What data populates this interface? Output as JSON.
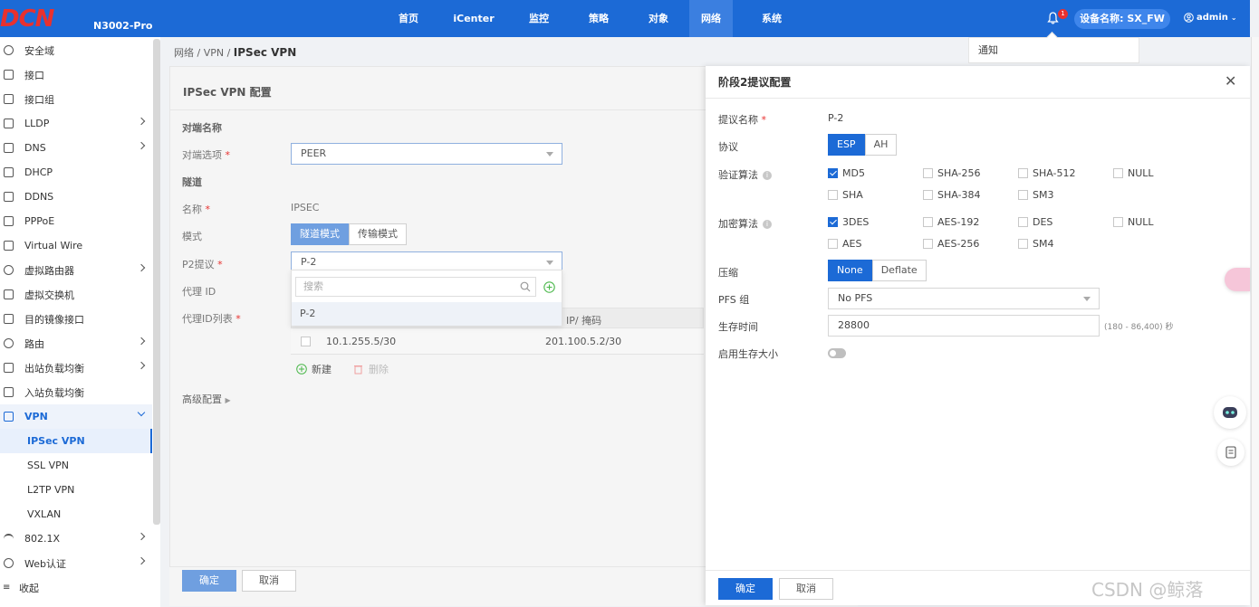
{
  "header": {
    "logo": "DCN",
    "model": "N3002-Pro",
    "nav": [
      "首页",
      "iCenter",
      "监控",
      "策略",
      "对象",
      "网络",
      "系统"
    ],
    "active_nav": "网络",
    "bell_badge": "1",
    "device_label": "设备名称: SX_FW",
    "user": "admin"
  },
  "notification": {
    "label": "通知"
  },
  "sidebar": {
    "items": [
      {
        "label": "安全域",
        "icon": "globe-icon"
      },
      {
        "label": "接口",
        "icon": "interface-icon"
      },
      {
        "label": "接口组",
        "icon": "interface-group-icon"
      },
      {
        "label": "LLDP",
        "icon": "lldp-icon",
        "arrow": true
      },
      {
        "label": "DNS",
        "icon": "dns-icon",
        "arrow": true
      },
      {
        "label": "DHCP",
        "icon": "dhcp-icon"
      },
      {
        "label": "DDNS",
        "icon": "ddns-icon"
      },
      {
        "label": "PPPoE",
        "icon": "pppoe-icon"
      },
      {
        "label": "Virtual Wire",
        "icon": "virtual-wire-icon"
      },
      {
        "label": "虚拟路由器",
        "icon": "router-icon",
        "arrow": true
      },
      {
        "label": "虚拟交换机",
        "icon": "switch-icon"
      },
      {
        "label": "目的镜像接口",
        "icon": "mirror-icon"
      },
      {
        "label": "路由",
        "icon": "route-icon",
        "arrow": true
      },
      {
        "label": "出站负载均衡",
        "icon": "outbound-lb-icon",
        "arrow": true
      },
      {
        "label": "入站负载均衡",
        "icon": "inbound-lb-icon"
      },
      {
        "label": "VPN",
        "icon": "vpn-icon",
        "open": true
      },
      {
        "label": "IPSec VPN",
        "sub": true,
        "active": true
      },
      {
        "label": "SSL VPN",
        "sub": true
      },
      {
        "label": "L2TP VPN",
        "sub": true
      },
      {
        "label": "VXLAN",
        "sub": true
      },
      {
        "label": "802.1X",
        "icon": "wifi-icon",
        "arrow": true
      },
      {
        "label": "Web认证",
        "icon": "web-auth-icon",
        "arrow": true
      }
    ],
    "collapse_label": "收起"
  },
  "breadcrumb": {
    "prefix": "网络 / VPN / ",
    "current": "IPSec VPN"
  },
  "panel": {
    "title": "IPSec VPN 配置",
    "peer_section": "对端名称",
    "peer_option_label": "对端选项",
    "peer_value": "PEER",
    "tunnel_section": "隧道",
    "name_label": "名称",
    "name_value": "IPSEC",
    "mode_label": "模式",
    "mode_options": [
      "隧道模式",
      "传输模式"
    ],
    "p2_label": "P2提议",
    "p2_value": "P-2",
    "dropdown_search_placeholder": "搜索",
    "dropdown_option": "P-2",
    "proxy_id_label": "代理 ID",
    "proxy_list_label": "代理ID列表",
    "table_header_right": "IP/ 掩码",
    "row_local": "10.1.255.5/30",
    "row_remote": "201.100.5.2/30",
    "new_label": "新建",
    "delete_label": "删除",
    "advanced_label": "高级配置",
    "ok_label": "确定",
    "cancel_label": "取消"
  },
  "drawer": {
    "title": "阶段2提议配置",
    "proposal_name_label": "提议名称",
    "proposal_name_value": "P-2",
    "protocol_label": "协议",
    "protocol_options": [
      "ESP",
      "AH"
    ],
    "auth_label": "验证算法",
    "auth_options": [
      {
        "label": "MD5",
        "checked": true
      },
      {
        "label": "SHA-256",
        "checked": false
      },
      {
        "label": "SHA-512",
        "checked": false
      },
      {
        "label": "NULL",
        "checked": false
      },
      {
        "label": "SHA",
        "checked": false
      },
      {
        "label": "SHA-384",
        "checked": false
      },
      {
        "label": "SM3",
        "checked": false
      }
    ],
    "enc_label": "加密算法",
    "enc_options": [
      {
        "label": "3DES",
        "checked": true
      },
      {
        "label": "AES-192",
        "checked": false
      },
      {
        "label": "DES",
        "checked": false
      },
      {
        "label": "NULL",
        "checked": false
      },
      {
        "label": "AES",
        "checked": false
      },
      {
        "label": "AES-256",
        "checked": false
      },
      {
        "label": "SM4",
        "checked": false
      }
    ],
    "compress_label": "压缩",
    "compress_options": [
      "None",
      "Deflate"
    ],
    "pfs_label": "PFS 组",
    "pfs_value": "No PFS",
    "lifetime_label": "生存时间",
    "lifetime_value": "28800",
    "lifetime_hint": "(180 - 86,400) 秒",
    "lifesize_label": "启用生存大小",
    "ok_label": "确定",
    "cancel_label": "取消"
  },
  "watermark": "CSDN @鲸落"
}
